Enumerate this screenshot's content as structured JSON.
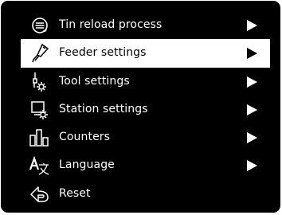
{
  "menu": {
    "items": [
      {
        "label": "Tin reload process",
        "icon": "tin-reel-icon",
        "has_submenu": true,
        "selected": false
      },
      {
        "label": "Feeder settings",
        "icon": "feeder-icon",
        "has_submenu": true,
        "selected": true
      },
      {
        "label": "Tool settings",
        "icon": "tool-settings-icon",
        "has_submenu": true,
        "selected": false
      },
      {
        "label": "Station settings",
        "icon": "station-settings-icon",
        "has_submenu": true,
        "selected": false
      },
      {
        "label": "Counters",
        "icon": "counters-icon",
        "has_submenu": true,
        "selected": false
      },
      {
        "label": "Language",
        "icon": "language-icon",
        "has_submenu": true,
        "selected": false
      },
      {
        "label": "Reset",
        "icon": "reset-icon",
        "has_submenu": false,
        "selected": false
      }
    ]
  },
  "colors": {
    "background": "#000000",
    "foreground": "#ffffff",
    "selected_background": "#ffffff",
    "selected_foreground": "#000000"
  }
}
